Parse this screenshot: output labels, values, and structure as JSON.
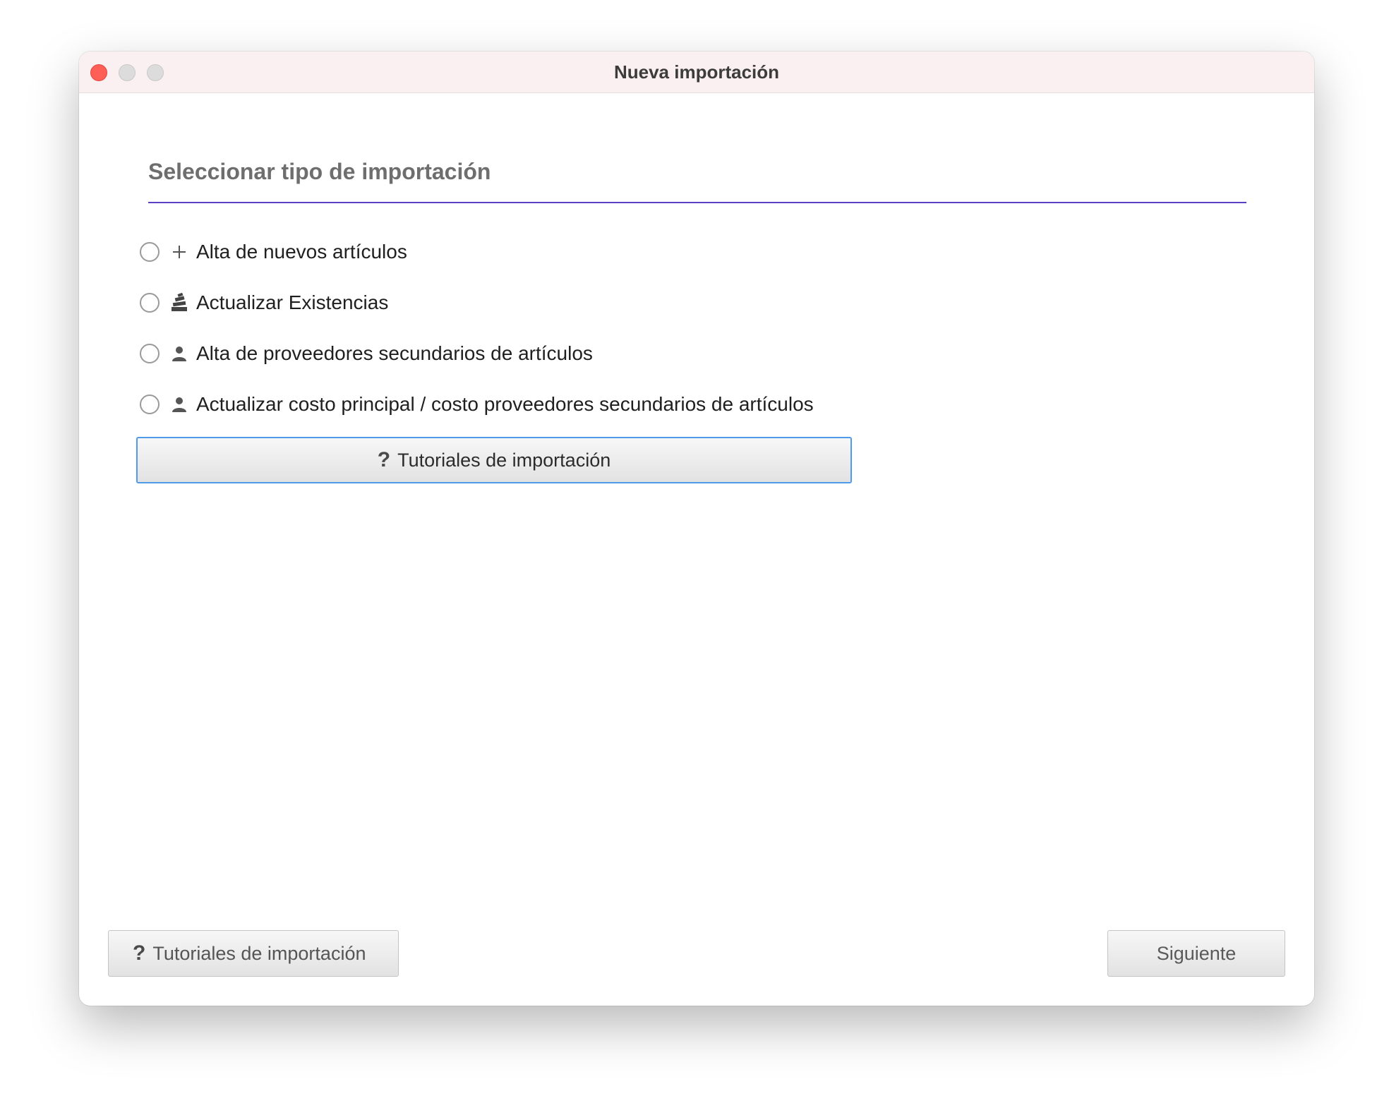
{
  "window": {
    "title": "Nueva importación"
  },
  "section": {
    "title": "Seleccionar tipo de importación"
  },
  "options": [
    {
      "label": "Alta de nuevos artículos",
      "icon": "plus-icon"
    },
    {
      "label": "Actualizar Existencias",
      "icon": "stacked-boxes-icon"
    },
    {
      "label": "Alta de proveedores secundarios de artículos",
      "icon": "person-icon"
    },
    {
      "label": "Actualizar costo principal / costo proveedores secundarios de artículos",
      "icon": "person-icon"
    }
  ],
  "tutorial_button": {
    "icon_glyph": "?",
    "label": "Tutoriales de importación"
  },
  "footer": {
    "tutorial_icon_glyph": "?",
    "tutorial_label": "Tutoriales de importación",
    "next_label": "Siguiente"
  },
  "colors": {
    "accent_rule": "#5b3fc4",
    "focus_border": "#4f9bea",
    "close_button": "#ff5f57",
    "titlebar_bg": "#fbf0f1"
  }
}
